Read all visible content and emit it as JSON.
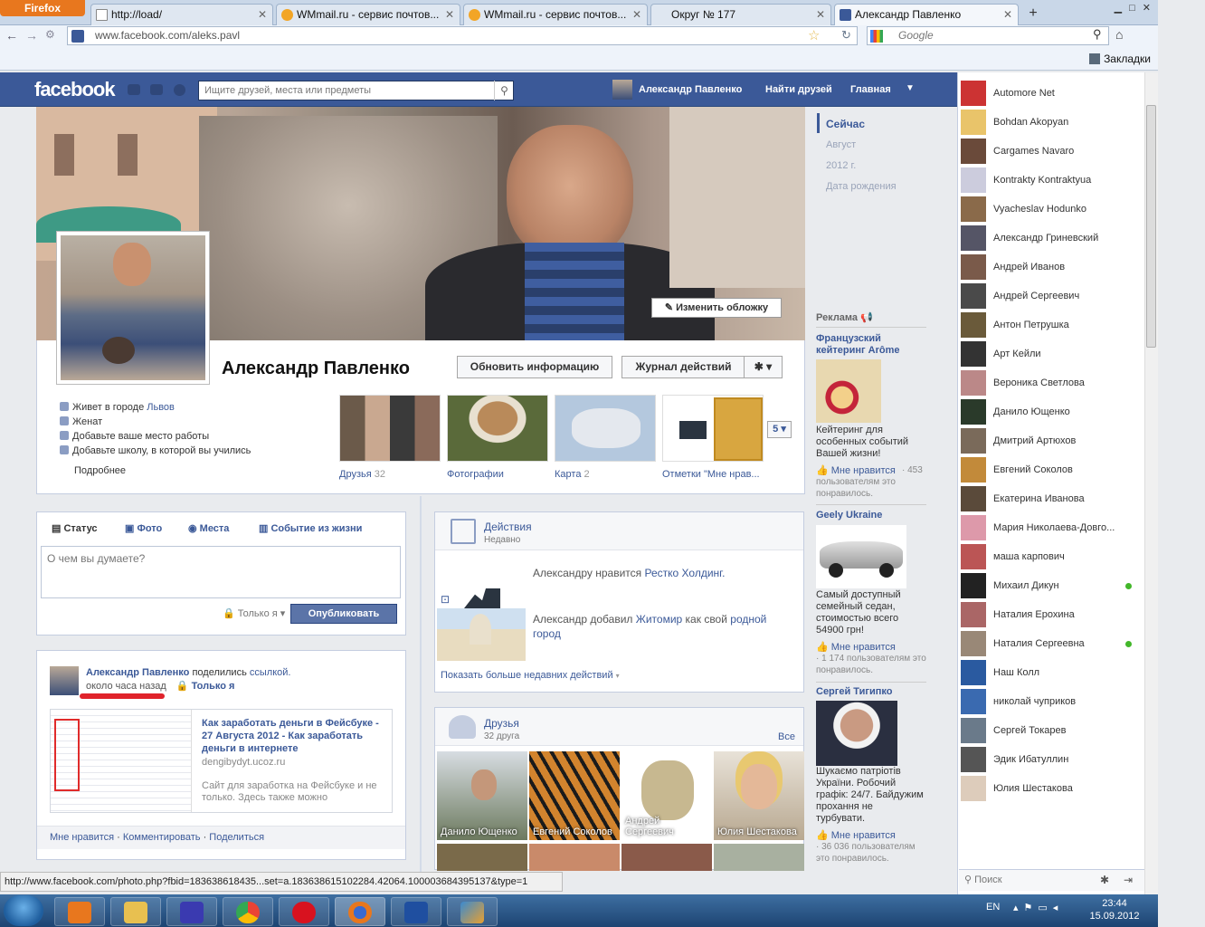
{
  "browser": {
    "firefox_label": "Firefox",
    "tabs": [
      {
        "title": "http://load/"
      },
      {
        "title": "WMmail.ru - сервис почтов..."
      },
      {
        "title": "WMmail.ru - сервис почтов..."
      },
      {
        "title": "Округ № 177"
      },
      {
        "title": "Александр Павленко"
      }
    ],
    "url": "www.facebook.com/aleks.pavl",
    "search_placeholder": "Google",
    "bookmarks_label": "Закладки",
    "status_url": "http://www.facebook.com/photo.php?fbid=183638618435...set=a.183638615102284.42064.100003684395137&type=1"
  },
  "fb_header": {
    "logo": "facebook",
    "search_placeholder": "Ищите друзей, места или предметы",
    "user_name": "Александр Павленко",
    "find_friends": "Найти друзей",
    "home": "Главная"
  },
  "profile": {
    "edit_cover": "Изменить обложку",
    "name": "Александр Павленко",
    "update_info": "Обновить информацию",
    "activity_log": "Журнал действий",
    "lives_in": "Живет в городе",
    "city": "Львов",
    "relationship": "Женат",
    "add_work": "Добавьте ваше место работы",
    "add_school": "Добавьте школу, в которой вы учились",
    "more": "Подробнее",
    "thumbs": [
      {
        "label": "Друзья",
        "count": "32"
      },
      {
        "label": "Фотографии",
        "count": ""
      },
      {
        "label": "Карта",
        "count": "2"
      },
      {
        "label": "Отметки \"Мне нрав...",
        "count": ""
      }
    ],
    "more_count": "5"
  },
  "timeline_nav": [
    "Сейчас",
    "Август",
    "2012 г.",
    "Дата рождения"
  ],
  "composer": {
    "tabs": [
      "Статус",
      "Фото",
      "Места",
      "Событие из жизни"
    ],
    "placeholder": "О чем вы думаете?",
    "privacy": "Только я",
    "publish": "Опубликовать"
  },
  "post": {
    "author": "Александр Павленко",
    "action": "поделились",
    "link_word": "ссылкой.",
    "time": "около часа назад",
    "privacy": "Только я",
    "link_title": "Как заработать деньги в Фейсбуке - 27 Августа 2012 - Как заработать деньги в интернете",
    "link_domain": "dengibydyt.ucoz.ru",
    "link_desc": "Сайт для заработка на Фейсбуке и не только. Здесь также можно",
    "like": "Мне нравится",
    "comment": "Комментировать",
    "share": "Поделиться"
  },
  "activity": {
    "title": "Действия",
    "subtitle": "Недавно",
    "item1_pre": "Александру нравится",
    "item1_link": "Рестко Холдинг.",
    "item2_pre": "Александр добавил",
    "item2_link": "Житомир",
    "item2_mid": "как свой",
    "item2_link2": "родной город",
    "show_more": "Показать больше недавних действий"
  },
  "friends": {
    "title": "Друзья",
    "count": "32 друга",
    "all": "Все",
    "list": [
      "Данило Ющенко",
      "Евгений Соколов",
      "Андрей Сергеевич",
      "Юлия Шестакова"
    ]
  },
  "ads": {
    "header": "Реклама",
    "items": [
      {
        "title": "Французский кейтеринг Arôme",
        "text": "Кейтеринг для особенных событий Вашей жизни!",
        "like": "Мне нравится",
        "count": "· 453 пользователям это понравилось."
      },
      {
        "title": "Geely Ukraine",
        "text": "Самый доступный семейный седан, стоимостью всего 54900 грн!",
        "like": "Мне нравится",
        "count": "· 1 174 пользователям это понравилось."
      },
      {
        "title": "Сергей Тигипко",
        "text": "Шукаємо патріотів України. Робочий графік: 24/7. Байдужим прохання не турбувати.",
        "like": "Мне нравится",
        "count": "· 36 036 пользователям это понравилось."
      }
    ]
  },
  "chat": {
    "contacts": [
      "Automore Net",
      "Bohdan Akopyan",
      "Cargames Navaro",
      "Kontrakty Kontraktyua",
      "Vyacheslav Hodunko",
      "Александр Гриневский",
      "Андрей Иванов",
      "Андрей Сергеевич",
      "Антон Петрушка",
      "Арт Кейли",
      "Вероника Светлова",
      "Данило Ющенко",
      "Дмитрий Артюхов",
      "Евгений Соколов",
      "Екатерина Иванова",
      "Мария Николаева-Довго...",
      "маша карпович",
      "Михаил Дикун",
      "Наталия Ерохина",
      "Наталия Сергеевна",
      "Наш Колл",
      "николай чуприков",
      "Сергей Токарев",
      "Эдик Ибатуллин",
      "Юлия Шестакова"
    ],
    "search": "Поиск"
  },
  "taskbar": {
    "lang": "EN",
    "time": "23:44",
    "date": "15.09.2012"
  }
}
